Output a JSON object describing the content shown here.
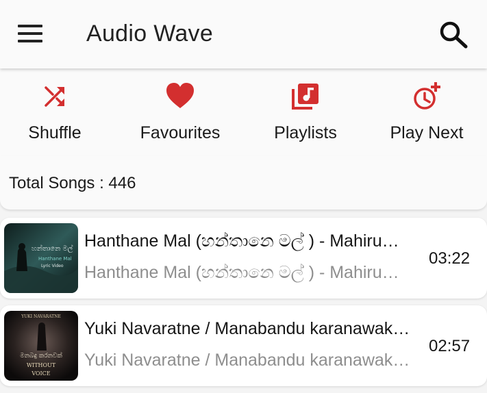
{
  "app": {
    "title": "Audio Wave"
  },
  "icons": {
    "menu": "hamburger-menu-icon",
    "search": "search-icon",
    "shuffle": "shuffle-icon",
    "favourites": "heart-icon",
    "playlists": "playlist-icon",
    "play_next": "clock-plus-icon"
  },
  "colors": {
    "accent": "#d32f2f",
    "primary_text": "#161616",
    "secondary_text": "#8e8e8e"
  },
  "actions": [
    {
      "label": "Shuffle"
    },
    {
      "label": "Favourites"
    },
    {
      "label": "Playlists"
    },
    {
      "label": "Play Next"
    }
  ],
  "library": {
    "total_songs": "Total Songs : 446"
  },
  "songs": [
    {
      "title": "Hanthane Mal (හන්තානෙ මල් )  - Mahiru…",
      "subtitle": "Hanthane Mal (හන්තානෙ මල් )  - Mahiru…",
      "duration": "03:22",
      "thumb_text": "හන්තානෙ මල්",
      "thumb_sub": "Hanthane Mal",
      "thumb_tag": "Lyric Video"
    },
    {
      "title": "Yuki Navaratne / Manabandu karanawak…",
      "subtitle": "Yuki Navaratne / Manabandu karanawak…",
      "duration": "02:57",
      "thumb_top": "YUKI NAVARATNE",
      "thumb_text": "මනබඳු කරනවක්",
      "thumb_sub": "WITHOUT",
      "thumb_tag": "VOICE"
    }
  ]
}
